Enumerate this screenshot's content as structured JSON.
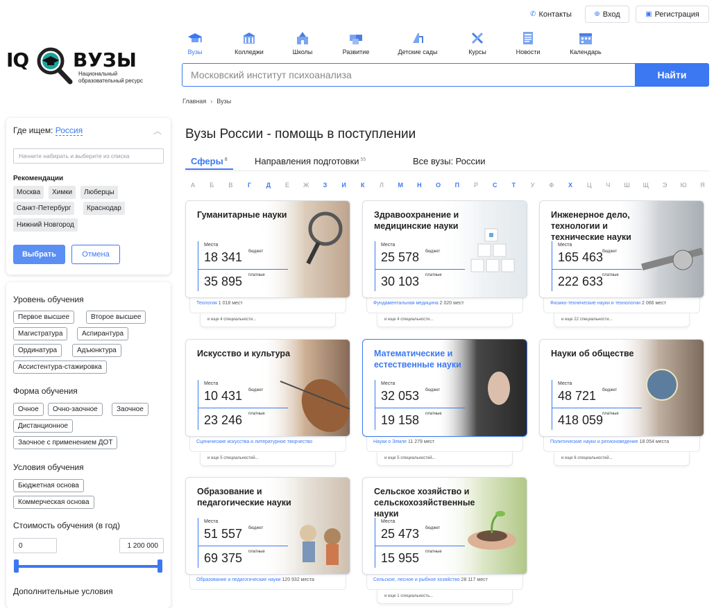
{
  "header": {
    "contacts": "Контакты",
    "login": "Вход",
    "register": "Регистрация"
  },
  "logo": {
    "iq": "IQ",
    "name": "ВУЗЫ",
    "subtitle_line1": "Национальный",
    "subtitle_line2": "образовательный ресурс"
  },
  "nav": [
    {
      "label": "Вузы",
      "icon": "graduation-cap-icon",
      "active": true
    },
    {
      "label": "Колледжи",
      "icon": "building-icon",
      "active": false
    },
    {
      "label": "Школы",
      "icon": "school-icon",
      "active": false
    },
    {
      "label": "Развитие",
      "icon": "puzzle-icon",
      "active": false
    },
    {
      "label": "Детские сады",
      "icon": "playground-icon",
      "active": false
    },
    {
      "label": "Курсы",
      "icon": "tools-icon",
      "active": false
    },
    {
      "label": "Новости",
      "icon": "newspaper-icon",
      "active": false
    },
    {
      "label": "Календарь",
      "icon": "calendar-icon",
      "active": false
    }
  ],
  "search": {
    "value": "Московский институт психоанализа",
    "button": "Найти"
  },
  "breadcrumb": {
    "home": "Главная",
    "current": "Вузы"
  },
  "page_title": "Вузы России - помощь в поступлении",
  "tabs": [
    {
      "label": "Сферы",
      "count": "8"
    },
    {
      "label": "Направления подготовки",
      "count": "55"
    },
    {
      "label": "Все вузы: России",
      "count": ""
    }
  ],
  "alphabet": [
    {
      "l": "А",
      "on": false
    },
    {
      "l": "Б",
      "on": false
    },
    {
      "l": "В",
      "on": false
    },
    {
      "l": "Г",
      "on": true
    },
    {
      "l": "Д",
      "on": true
    },
    {
      "l": "Е",
      "on": false
    },
    {
      "l": "Ж",
      "on": false
    },
    {
      "l": "З",
      "on": true
    },
    {
      "l": "И",
      "on": true
    },
    {
      "l": "К",
      "on": true
    },
    {
      "l": "Л",
      "on": false
    },
    {
      "l": "М",
      "on": true
    },
    {
      "l": "Н",
      "on": true
    },
    {
      "l": "О",
      "on": true
    },
    {
      "l": "П",
      "on": true
    },
    {
      "l": "Р",
      "on": false
    },
    {
      "l": "С",
      "on": true
    },
    {
      "l": "Т",
      "on": true
    },
    {
      "l": "У",
      "on": false
    },
    {
      "l": "Ф",
      "on": false
    },
    {
      "l": "Х",
      "on": true
    },
    {
      "l": "Ц",
      "on": false
    },
    {
      "l": "Ч",
      "on": false
    },
    {
      "l": "Ш",
      "on": false
    },
    {
      "l": "Щ",
      "on": false
    },
    {
      "l": "Э",
      "on": false
    },
    {
      "l": "Ю",
      "on": false
    },
    {
      "l": "Я",
      "on": false
    }
  ],
  "card_labels": {
    "places": "Места",
    "budget": "бюджет",
    "paid": "платные"
  },
  "cards": [
    {
      "title": "Гуманитарные науки",
      "budget": "18 341",
      "paid": "35 895",
      "spec": "Теология",
      "spec_count": "1 018 мест",
      "more": "и еще 4 специальности...",
      "img": "magnifier-image"
    },
    {
      "title": "Здравоохранение и медицинские науки",
      "budget": "25 578",
      "paid": "30 103",
      "spec": "Фундаментальная медицина",
      "spec_count": "2 020 мест",
      "more": "и еще 4 специальности...",
      "img": "medical-blocks-image"
    },
    {
      "title": "Инженерное дело, технологии и технические науки",
      "budget": "165 463",
      "paid": "222 633",
      "spec": "Физико-технические науки и технологии",
      "spec_count": "2 066 мест",
      "more": "и еще 22 специальности...",
      "img": "caliper-image"
    },
    {
      "title": "Искусство и культура",
      "budget": "10 431",
      "paid": "23 246",
      "spec": "Сценические искусства и литературное творчество",
      "spec_count": "",
      "more": "и еще 5 специальностей...",
      "img": "violin-image"
    },
    {
      "title": "Математические и естественные науки",
      "budget": "32 053",
      "paid": "19 158",
      "spec": "Науки о Земле",
      "spec_count": "11 279 мест",
      "more": "и еще 5 специальностей...",
      "img": "chalkboard-image"
    },
    {
      "title": "Науки об обществе",
      "budget": "48 721",
      "paid": "418 059",
      "spec": "Политические науки и регионоведение",
      "spec_count": "18 054 места",
      "more": "и еще 6 специальностей...",
      "img": "globe-hands-image"
    },
    {
      "title": "Образование и педагогические науки",
      "budget": "51 557",
      "paid": "69 375",
      "spec": "Образование и педагогические науки",
      "spec_count": "120 932 места",
      "more": "",
      "img": "classroom-image"
    },
    {
      "title": "Сельское хозяйство и сельскохозяйственные науки",
      "budget": "25 473",
      "paid": "15 955",
      "spec": "Сельское, лесное и рыбное хозяйство",
      "spec_count": "28 117 мест",
      "more": "и еще 1 специальность...",
      "img": "seedling-image"
    }
  ],
  "location": {
    "label": "Где ищем:",
    "value": "Россия",
    "placeholder": "Начните набирать и выберите из списка",
    "rec_title": "Рекомендации",
    "recs": [
      "Москва",
      "Химки",
      "Люберцы",
      "Санкт-Петербург",
      "Краснодар",
      "Нижний Новгород"
    ],
    "ok": "Выбрать",
    "cancel": "Отмена"
  },
  "filters": {
    "level_title": "Уровень обучения",
    "levels": [
      "Первое высшее",
      "Второе высшее",
      "Магистратура",
      "Аспирантура",
      "Ординатура",
      "Адъюнктура",
      "Ассистентура-стажировка"
    ],
    "form_title": "Форма обучения",
    "forms": [
      "Очное",
      "Очно-заочное",
      "Заочное",
      "Дистанционное",
      "Заочное с применением ДОТ"
    ],
    "cond_title": "Условия обучения",
    "conds": [
      "Бюджетная основа",
      "Коммерческая основа"
    ],
    "cost_title": "Стоимость обучения (в год)",
    "cost_min": "0",
    "cost_max": "1 200 000",
    "extra_title": "Дополнительные условия"
  },
  "colors": {
    "accent": "#3b78f2",
    "chip": "#e9eaec"
  }
}
